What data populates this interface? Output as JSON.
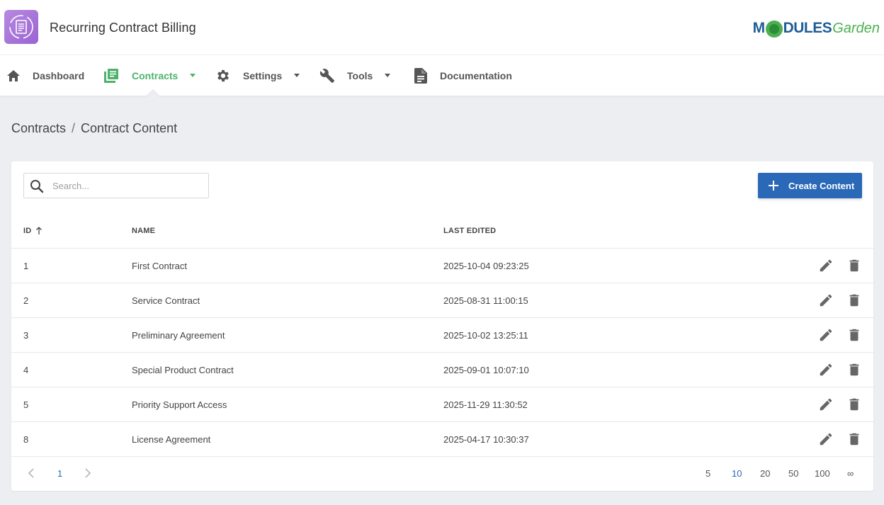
{
  "app": {
    "title": "Recurring Contract Billing"
  },
  "brand": {
    "m": "M",
    "dules": "DULES",
    "garden": "Garden"
  },
  "nav": {
    "dashboard": "Dashboard",
    "contracts": "Contracts",
    "settings": "Settings",
    "tools": "Tools",
    "documentation": "Documentation"
  },
  "breadcrumb": {
    "parent": "Contracts",
    "separator": "/",
    "current": "Contract Content"
  },
  "search": {
    "placeholder": "Search..."
  },
  "toolbar": {
    "create_label": "Create Content"
  },
  "table": {
    "headers": {
      "id": "ID",
      "name": "NAME",
      "last_edited": "LAST EDITED"
    },
    "rows": [
      {
        "id": "1",
        "name": "First Contract",
        "last_edited": "2025-10-04 09:23:25"
      },
      {
        "id": "2",
        "name": "Service Contract",
        "last_edited": "2025-08-31 11:00:15"
      },
      {
        "id": "3",
        "name": "Preliminary Agreement",
        "last_edited": "2025-10-02 13:25:11"
      },
      {
        "id": "4",
        "name": "Special Product Contract",
        "last_edited": "2025-09-01 10:07:10"
      },
      {
        "id": "5",
        "name": "Priority Support Access",
        "last_edited": "2025-11-29 11:30:52"
      },
      {
        "id": "8",
        "name": "License Agreement",
        "last_edited": "2025-04-17 10:30:37"
      }
    ]
  },
  "pagination": {
    "current_page": "1",
    "page_sizes": [
      "5",
      "10",
      "20",
      "50",
      "100",
      "∞"
    ],
    "selected_size": "10"
  },
  "colors": {
    "accent_green": "#4db36b",
    "primary_blue": "#2a68b8",
    "logo_purple": "#9b63d4"
  }
}
